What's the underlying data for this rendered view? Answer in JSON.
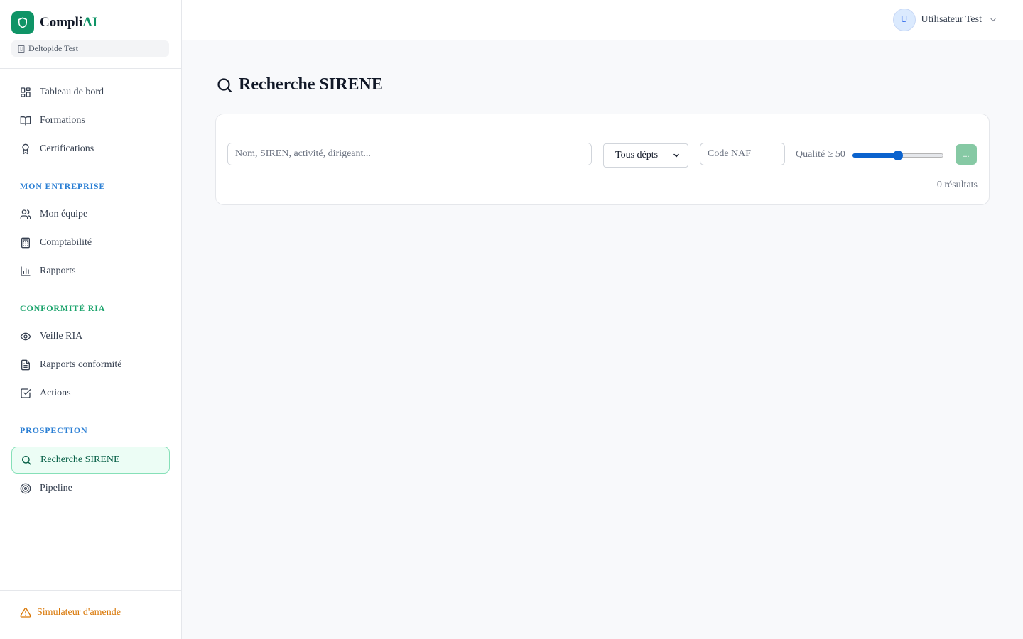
{
  "brand": {
    "name_main": "Compli",
    "name_accent": "AI",
    "org": "Deltopide Test"
  },
  "sidebar": {
    "main_items": [
      {
        "label": "Tableau de bord",
        "icon": "layout-grid-icon"
      },
      {
        "label": "Formations",
        "icon": "book-open-icon"
      },
      {
        "label": "Certifications",
        "icon": "award-icon"
      }
    ],
    "sections": [
      {
        "title": "MON ENTREPRISE",
        "color": "#2b7fd4",
        "items": [
          {
            "label": "Mon équipe",
            "icon": "users-icon"
          },
          {
            "label": "Comptabilité",
            "icon": "calculator-icon"
          },
          {
            "label": "Rapports",
            "icon": "bar-chart-icon"
          }
        ]
      },
      {
        "title": "CONFORMITÉ RIA",
        "color": "#1aa36b",
        "items": [
          {
            "label": "Veille RIA",
            "icon": "eye-icon"
          },
          {
            "label": "Rapports conformité",
            "icon": "file-text-icon"
          },
          {
            "label": "Actions",
            "icon": "check-square-icon"
          }
        ]
      },
      {
        "title": "PROSPECTION",
        "color": "#2b7fd4",
        "items": [
          {
            "label": "Recherche SIRENE",
            "icon": "search-icon",
            "active": true
          },
          {
            "label": "Pipeline",
            "icon": "target-icon"
          }
        ]
      }
    ],
    "footer_link": "Simulateur d'amende"
  },
  "header": {
    "avatar_initial": "U",
    "user_name": "Utilisateur Test"
  },
  "main": {
    "title": "Recherche SIRENE",
    "search": {
      "placeholder": "Nom, SIREN, activité, dirigeant...",
      "value": ""
    },
    "dept_select": {
      "selected": "Tous dépts"
    },
    "naf": {
      "placeholder": "Code NAF",
      "value": ""
    },
    "quality": {
      "label": "Qualité ≥ 50",
      "value": 50,
      "min": 0,
      "max": 100
    },
    "go_button": "...",
    "results_count": "0 résultats"
  },
  "colors": {
    "brand": "#0f9466",
    "warning": "#d97706"
  }
}
